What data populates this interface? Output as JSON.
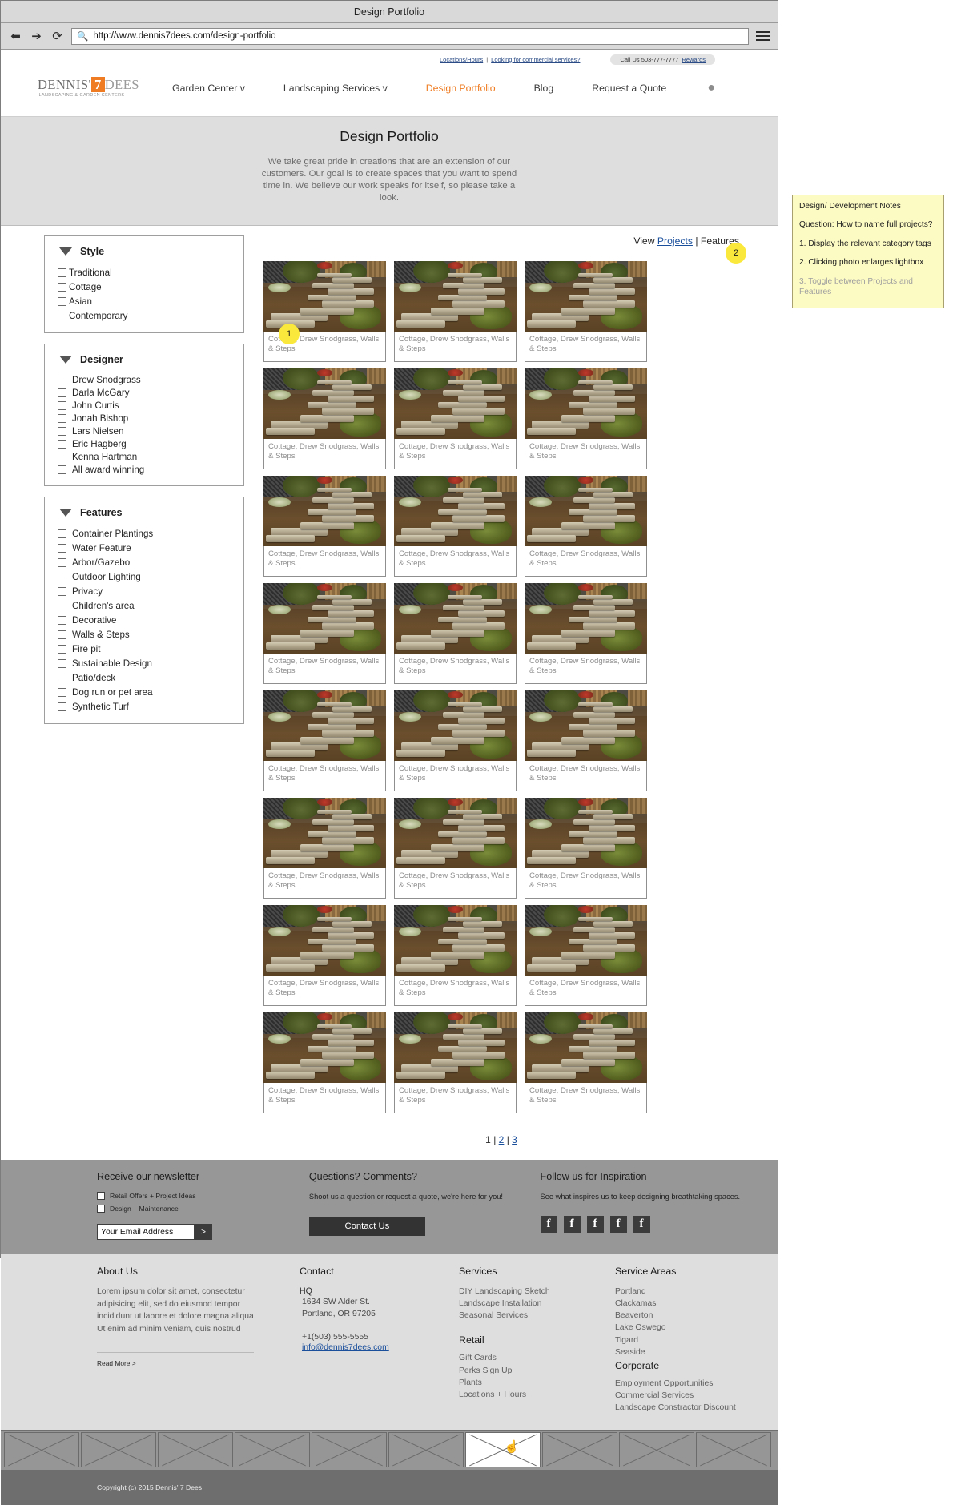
{
  "browser": {
    "window_title": "Design Portfolio",
    "url": "http://www.dennis7dees.com/design-portfolio",
    "back_icon": "back-arrow-icon",
    "forward_icon": "forward-arrow-icon",
    "reload_icon": "reload-icon",
    "search_icon": "search-icon",
    "menu_icon": "hamburger-menu-icon"
  },
  "site_header": {
    "utility": {
      "locations_hours": "Locations/Hours",
      "separator": "|",
      "commercial": "Looking for commercial services?",
      "call_us": "Call Us 503-777-7777",
      "rewards": "Rewards"
    },
    "logo": {
      "dennis": "DENNIS'",
      "seven": "7",
      "dees": "DEES",
      "tagline": "LANDSCAPING & GARDEN CENTERS"
    },
    "nav": [
      {
        "label": "Garden Center v",
        "active": false
      },
      {
        "label": "Landscaping Services v",
        "active": false
      },
      {
        "label": "Design Portfolio",
        "active": true
      },
      {
        "label": "Blog",
        "active": false
      },
      {
        "label": "Request a Quote",
        "active": false
      }
    ],
    "pin_icon": "location-pin-icon"
  },
  "hero": {
    "title": "Design Portfolio",
    "text": "We take great pride in creations that are an extension of our customers. Our goal is to create spaces that you want to spend time in.\nWe believe our work speaks for itself, so please take a look."
  },
  "sidebar": {
    "facets": [
      {
        "title": "Style",
        "items": [
          "Traditional",
          "Cottage",
          "Asian",
          "Contemporary"
        ]
      },
      {
        "title": "Designer",
        "items": [
          "Drew Snodgrass",
          "Darla McGary",
          "John Curtis",
          "Jonah Bishop",
          "Lars Nielsen",
          "Eric Hagberg",
          "Kenna Hartman",
          "All award winning"
        ]
      },
      {
        "title": "Features",
        "items": [
          "Container Plantings",
          "Water Feature",
          "Arbor/Gazebo",
          "Outdoor Lighting",
          "Privacy",
          "Children's area",
          "Decorative",
          "Walls & Steps",
          "Fire pit",
          "Sustainable Design",
          "Patio/deck",
          "Dog run or pet area",
          "Synthetic Turf"
        ]
      }
    ]
  },
  "gallery": {
    "view_label": "View",
    "view_projects": "Projects",
    "view_sep": "|",
    "view_features": "Features",
    "caption": "Cottage, Drew Snodgrass, Walls & Steps",
    "item_count": 24,
    "pagination": {
      "current": "1",
      "sep": "|",
      "pages": [
        "2",
        "3"
      ]
    }
  },
  "callouts": [
    {
      "id": "1",
      "label": "1"
    },
    {
      "id": "2",
      "label": "2"
    }
  ],
  "notes": {
    "title": "Design/ Development Notes",
    "question": "Question: How to name full projects?",
    "item1": "1. Display the relevant category tags",
    "item2": "2. Clicking photo enlarges lightbox",
    "item3": "3. Toggle between Projects and Features"
  },
  "footer": {
    "newsletter": {
      "heading": "Receive our newsletter",
      "check1": "Retail Offers + Project Ideas",
      "check2": "Design + Maintenance",
      "email_placeholder": "Your Email Address",
      "submit_label": ">"
    },
    "questions": {
      "heading": "Questions? Comments?",
      "text": "Shoot us a question or request a quote, we're here for you!",
      "button": "Contact Us"
    },
    "follow": {
      "heading": "Follow us for Inspiration",
      "text": "See what inspires us to keep designing breathtaking spaces.",
      "social_icons": [
        "facebook-icon",
        "facebook-icon",
        "facebook-icon",
        "facebook-icon",
        "facebook-icon"
      ],
      "social_glyph": "f"
    },
    "about": {
      "heading": "About Us",
      "text": "Lorem ipsum dolor sit amet, consectetur adipisicing elit, sed do eiusmod tempor incididunt ut labore et dolore magna aliqua. Ut enim ad minim veniam, quis nostrud",
      "read_more": "Read More >"
    },
    "contact": {
      "heading": "Contact",
      "hq": "HQ",
      "street": "1634 SW Alder St.",
      "city": "Portland, OR 97205",
      "phone": "+1(503) 555-5555",
      "email": "info@dennis7dees.com"
    },
    "services": {
      "heading": "Services",
      "items": [
        "DIY Landscaping Sketch",
        "Landscape Installation",
        "Seasonal Services"
      ],
      "retail_heading": "Retail",
      "retail_items": [
        "Gift Cards",
        "Perks Sign Up",
        "Plants",
        "Locations + Hours"
      ]
    },
    "service_areas": {
      "heading": "Service Areas",
      "items": [
        "Portland",
        "Clackamas",
        "Beaverton",
        "Lake Oswego",
        "Tigard",
        "Seaside"
      ],
      "corporate_heading": "Corporate",
      "corporate_items": [
        "Employment Opportunities",
        "Commercial Services",
        "Landscape Constractor Discount"
      ]
    },
    "copyright": "Copyright (c) 2015 Dennis' 7 Dees"
  },
  "taskbar": {
    "tiles": 10,
    "active_index": 6,
    "cursor_icon": "hand-cursor-icon"
  },
  "colors": {
    "accent": "#ef7c22",
    "link": "#1a4f9c",
    "note_bg": "#fdfbc4",
    "badge": "#fbe83c"
  }
}
